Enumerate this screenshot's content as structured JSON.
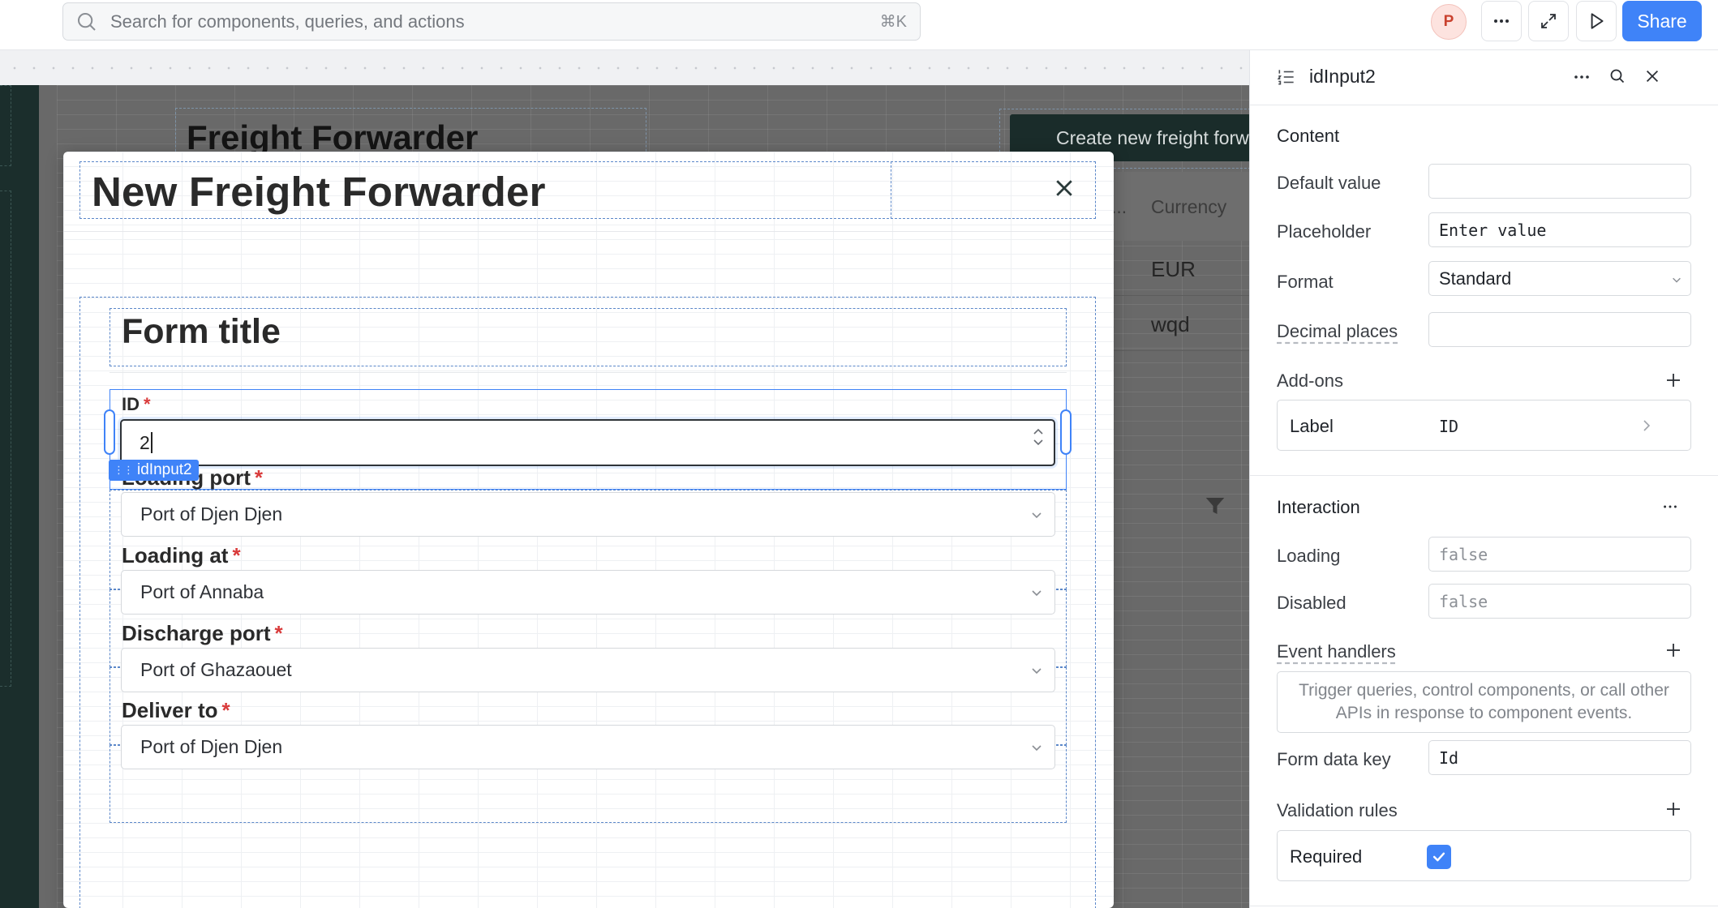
{
  "topbar": {
    "search_placeholder": "Search for components, queries, and actions",
    "search_shortcut": "⌘K",
    "avatar_initial": "P",
    "share_label": "Share"
  },
  "canvas": {
    "page_title": "Freight Forwarder",
    "create_button": "Create new freight forw",
    "table": {
      "header_truncated": "...",
      "column_header": "Currency",
      "rows": [
        "EUR",
        "wqd"
      ]
    }
  },
  "modal": {
    "title": "New Freight Forwarder",
    "form_title": "Form title",
    "fields": {
      "id": {
        "label": "ID",
        "value": "2",
        "required_mark": "*"
      },
      "loading_port": {
        "label": "Loading port",
        "value": "Port of Djen Djen",
        "required_mark": "*"
      },
      "loading_at": {
        "label": "Loading at",
        "value": "Port of Annaba",
        "required_mark": "*"
      },
      "discharge_port": {
        "label": "Discharge port",
        "value": "Port of Ghazaouet",
        "required_mark": "*"
      },
      "deliver_to": {
        "label": "Deliver to",
        "value": "Port of Djen Djen",
        "required_mark": "*"
      }
    },
    "selected_component_tag": "idInput2"
  },
  "inspector": {
    "component_name": "idInput2",
    "content": {
      "section_title": "Content",
      "default_value": {
        "label": "Default value",
        "value": ""
      },
      "placeholder": {
        "label": "Placeholder",
        "value": "Enter value"
      },
      "format": {
        "label": "Format",
        "value": "Standard"
      },
      "decimal_places": {
        "label": "Decimal places",
        "value": ""
      },
      "addons": {
        "label": "Add-ons",
        "row_key": "Label",
        "row_value": "ID"
      }
    },
    "interaction": {
      "section_title": "Interaction",
      "loading": {
        "label": "Loading",
        "value": "false"
      },
      "disabled": {
        "label": "Disabled",
        "value": "false"
      },
      "event_handlers": {
        "label": "Event handlers",
        "hint": "Trigger queries, control components, or call other APIs in response to component events."
      },
      "form_data_key": {
        "label": "Form data key",
        "value": "Id"
      },
      "validation_rules": {
        "label": "Validation rules",
        "required_label": "Required",
        "required_checked": true
      }
    }
  },
  "colors": {
    "accent": "#3f83f8",
    "required": "#d93b3b",
    "app_dark": "#1a2c2a"
  }
}
